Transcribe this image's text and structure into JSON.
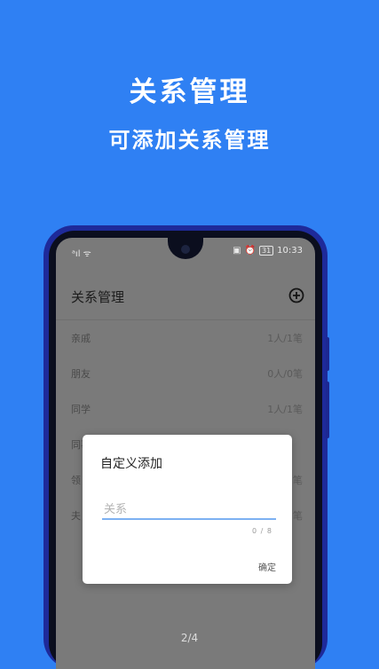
{
  "headline": "关系管理",
  "subline": "可添加关系管理",
  "status_bar": {
    "signal": "ᵃıl",
    "wifi": "ᯤ",
    "battery": "31",
    "time": "10:33"
  },
  "app_bar": {
    "title": "关系管理",
    "add_icon": "plus-circle-icon"
  },
  "relations": [
    {
      "label": "亲戚",
      "count": "1人/1笔"
    },
    {
      "label": "朋友",
      "count": "0人/0笔"
    },
    {
      "label": "同学",
      "count": "1人/1笔"
    },
    {
      "label": "同事",
      "count": ""
    },
    {
      "label": "领",
      "count": "笔"
    },
    {
      "label": "夫",
      "count": "笔"
    }
  ],
  "dialog": {
    "title": "自定义添加",
    "input_placeholder": "关系",
    "input_value": "",
    "counter": "0 / 8",
    "confirm_label": "确定"
  },
  "pager": "2/4",
  "colors": {
    "background": "#2f80f3",
    "phone_frame": "#1e2a9a",
    "screen_dim": "#7a7a7a",
    "input_underline": "#7db1f2"
  }
}
